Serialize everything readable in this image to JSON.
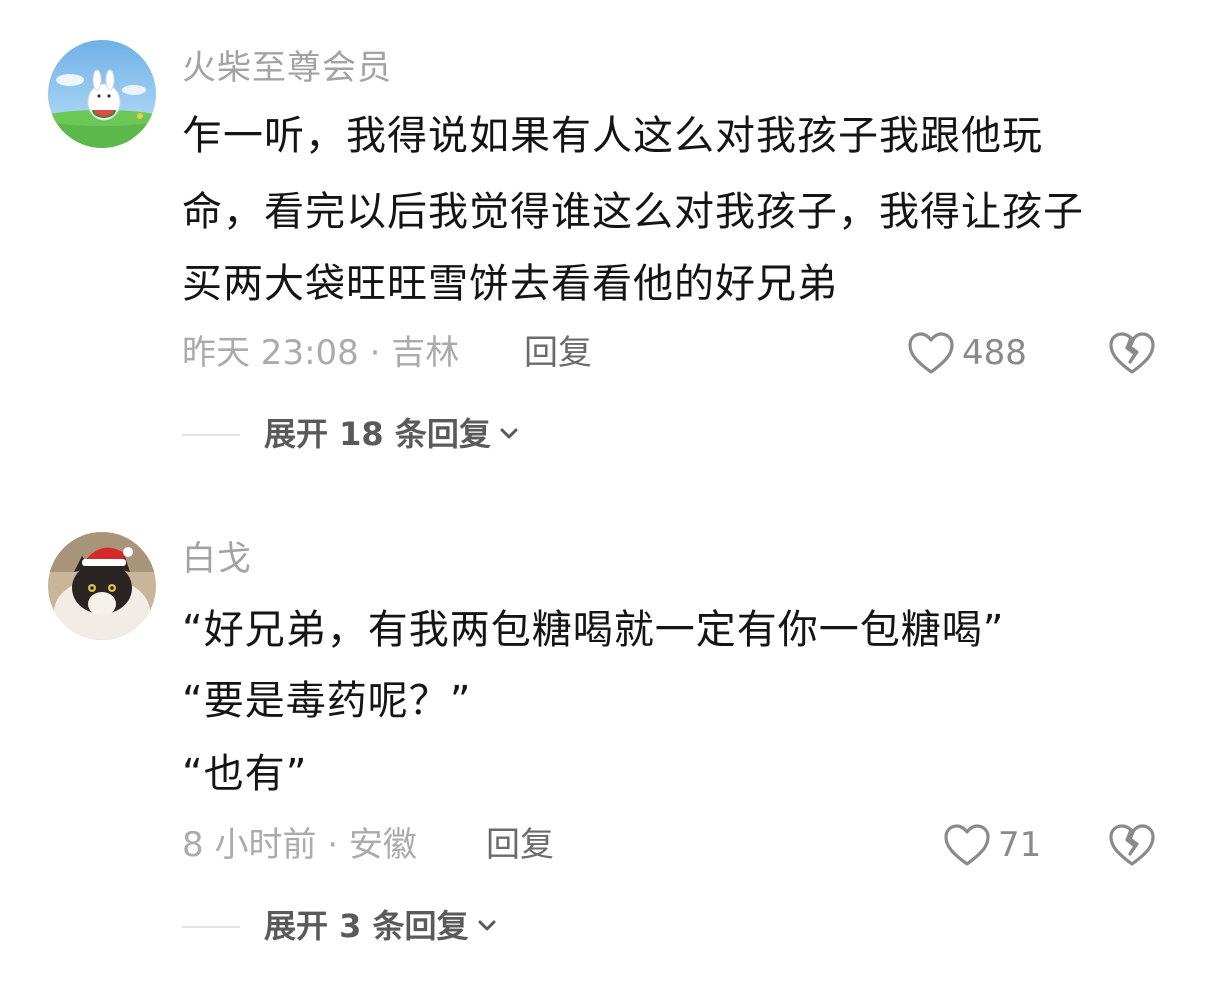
{
  "comments": [
    {
      "username": "火柴至尊会员",
      "text_lines": [
        "乍一听，我得说如果有人这么对我孩子我跟他玩",
        "命，看完以后我觉得谁这么对我孩子，我得让孩子",
        "买两大袋旺旺雪饼去看看他的好兄弟"
      ],
      "meta": "昨天 23:08 · 吉林",
      "reply_label": "回复",
      "likes": "488",
      "expand_label": "展开 18 条回复",
      "avatar_icon": "cartoon-bunny-watermelon-avatar"
    },
    {
      "username": "白戈",
      "text_lines": [
        "“好兄弟，有我两包糖喝就一定有你一包糖喝”",
        "“要是毒药呢？”",
        "“也有”"
      ],
      "meta": "8 小时前 · 安徽",
      "reply_label": "回复",
      "likes": "71",
      "expand_label": "展开 3 条回复",
      "avatar_icon": "cat-santa-hat-avatar"
    }
  ],
  "icons": {
    "like": "heart-outline-icon",
    "dislike": "broken-heart-icon",
    "expand": "chevron-down-icon"
  },
  "colors": {
    "username": "#a3a3a3",
    "text": "#141414",
    "meta": "#ababab",
    "reply": "#6b6b6b",
    "icon": "#8a8a8a"
  }
}
